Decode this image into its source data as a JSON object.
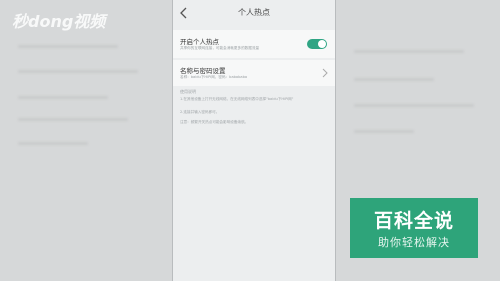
{
  "watermark": {
    "text": "秒dong视频",
    "sub": ""
  },
  "header": {
    "title": "个人热点"
  },
  "hotspot_toggle": {
    "label": "开启个人热点",
    "sub": "共享你的互联网连接，可能会消耗更多的数据流量",
    "on": true,
    "accent": "#2fa584"
  },
  "name_password": {
    "label": "名称与密码设置",
    "sub": "名称：baidu下HiPi网，密码：babababa"
  },
  "hints": {
    "heading": "使用说明",
    "lines": [
      "1.在其他设备上打开无线网络，在无线网络列表中选择\"baidu下HiPi网\"",
      "2.连接并输入密码即可。",
      "注意：频繁开关热点可能会影响设备续航。"
    ]
  },
  "brand_logo": {
    "title": "百科全说",
    "subtitle": "助你轻松解决",
    "color": "#2ea47a"
  }
}
